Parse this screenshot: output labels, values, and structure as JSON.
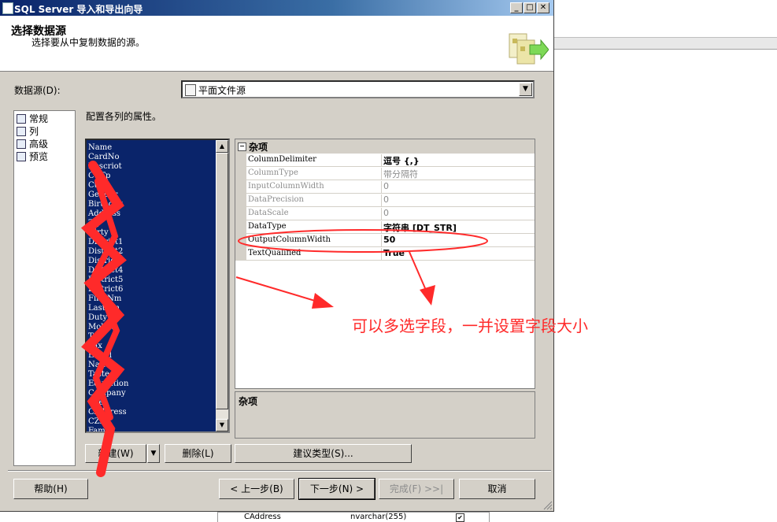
{
  "dialog": {
    "title": "SQL Server 导入和导出向导",
    "header_title": "选择数据源",
    "header_subtitle": "选择要从中复制数据的源。"
  },
  "data_source": {
    "label": "数据源(D):",
    "value": "平面文件源"
  },
  "nav": {
    "items": [
      {
        "label": "常规",
        "icon": "general-icon"
      },
      {
        "label": "列",
        "icon": "columns-icon"
      },
      {
        "label": "高级",
        "icon": "advanced-icon"
      },
      {
        "label": "预览",
        "icon": "preview-icon"
      }
    ]
  },
  "instruction": "配置各列的属性。",
  "columns": [
    "Name",
    "CardNo",
    "Descriot",
    "CtfTp",
    "CtfId",
    "Gender",
    "Birthday",
    "Address",
    "Zip",
    "Dirty",
    "District1",
    "District2",
    "District3",
    "District4",
    "District5",
    "District6",
    "FirstNm",
    "LastNm",
    "Duty",
    "Mobile",
    "Tel",
    "Fax",
    "EMail",
    "Nation",
    "Taste",
    "Education",
    "Company",
    "CTel",
    "CAddress",
    "CZip",
    "Family"
  ],
  "properties": {
    "category": "杂项",
    "rows": [
      {
        "name": "ColumnDelimiter",
        "value": "逗号 {,}",
        "enabled": true,
        "bold": true
      },
      {
        "name": "ColumnType",
        "value": "带分隔符",
        "enabled": false,
        "bold": false
      },
      {
        "name": "InputColumnWidth",
        "value": "0",
        "enabled": false,
        "bold": false
      },
      {
        "name": "DataPrecision",
        "value": "0",
        "enabled": false,
        "bold": false
      },
      {
        "name": "DataScale",
        "value": "0",
        "enabled": false,
        "bold": false
      },
      {
        "name": "DataType",
        "value": "字符串 [DT_STR]",
        "enabled": true,
        "bold": true
      },
      {
        "name": "OutputColumnWidth",
        "value": "50",
        "enabled": true,
        "bold": true
      },
      {
        "name": "TextQualified",
        "value": "True",
        "enabled": true,
        "bold": true
      }
    ],
    "description_title": "杂项"
  },
  "buttons": {
    "new": "新建(W)",
    "delete": "删除(L)",
    "suggest_types": "建议类型(S)...",
    "help": "帮助(H)",
    "back": "< 上一步(B)",
    "next": "下一步(N) >",
    "finish": "完成(F) >>|",
    "cancel": "取消"
  },
  "background": {
    "row_name": "CAddress",
    "row_type": "nvarchar(255)"
  },
  "annotation": {
    "text": "可以多选字段，一并设置字段大小",
    "color": "#ff2a2a"
  },
  "colors": {
    "title_start": "#0a246a",
    "title_end": "#a6caf0",
    "list_selection": "#0a246a",
    "dialog_face": "#d4d0c8"
  }
}
